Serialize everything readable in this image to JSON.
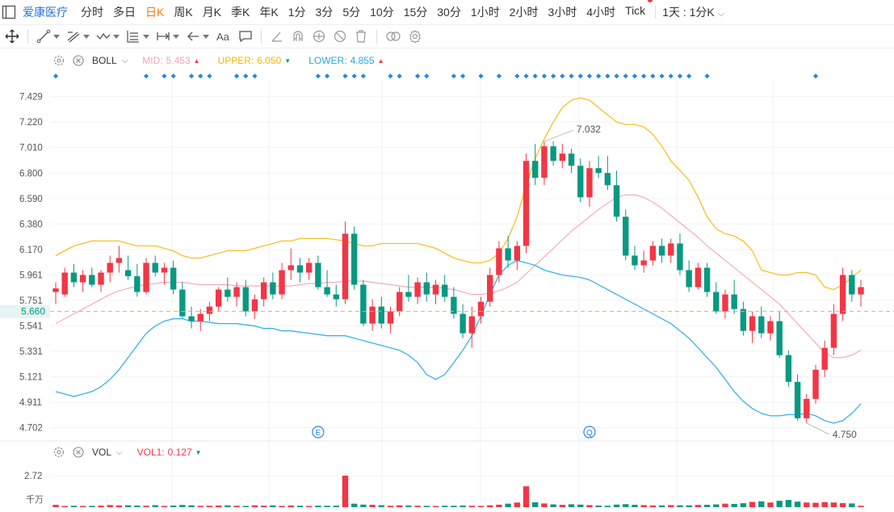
{
  "stock_name": "爱康医疗",
  "periods": [
    "分时",
    "多日",
    "日K",
    "周K",
    "月K",
    "季K",
    "年K",
    "1分",
    "3分",
    "5分",
    "10分",
    "15分",
    "30分",
    "1小时",
    "2小时",
    "3小时",
    "4小时",
    "Tick"
  ],
  "active_period": "日K",
  "range_label": "1天 : 1分K",
  "boll": {
    "name": "BOLL",
    "mid_label": "MID:",
    "mid": "5.453",
    "upper_label": "UPPER:",
    "upper": "6.050",
    "lower_label": "LOWER:",
    "lower": "4.855"
  },
  "vol": {
    "name": "VOL",
    "vol1_label": "VOL1:",
    "vol1": "0.127",
    "max_label": "2.72",
    "unit": "千万"
  },
  "colors": {
    "up": "#f23645",
    "down": "#089981",
    "mid": "#f5a3b8",
    "upper": "#f5c228",
    "lower": "#3ab4e6",
    "price_line": "#f5a56b",
    "accent": "#2a71d4",
    "active": "#f57a00"
  },
  "last_price": "5.660",
  "high_marker": "7.032",
  "low_marker": "4.750",
  "event_markers": [
    "E",
    "Q"
  ],
  "chart_data": {
    "type": "candlestick",
    "y_ticks": [
      "7.429",
      "7.220",
      "7.010",
      "6.800",
      "6.590",
      "6.380",
      "6.170",
      "5.961",
      "5.751",
      "5.541",
      "5.331",
      "5.121",
      "4.911",
      "4.702"
    ],
    "ylim": [
      4.6,
      7.56
    ],
    "n": 90,
    "ohlc": [
      [
        5.82,
        5.9,
        5.72,
        5.85
      ],
      [
        5.8,
        6.02,
        5.78,
        5.98
      ],
      [
        5.98,
        6.05,
        5.86,
        5.9
      ],
      [
        5.9,
        6.0,
        5.82,
        5.96
      ],
      [
        5.96,
        6.02,
        5.86,
        5.88
      ],
      [
        5.88,
        6.0,
        5.82,
        5.98
      ],
      [
        5.98,
        6.12,
        5.9,
        6.06
      ],
      [
        6.06,
        6.2,
        5.98,
        6.1
      ],
      [
        6.0,
        6.12,
        5.92,
        5.95
      ],
      [
        5.95,
        6.05,
        5.78,
        5.82
      ],
      [
        5.82,
        6.1,
        5.8,
        6.06
      ],
      [
        6.06,
        6.12,
        5.95,
        5.98
      ],
      [
        5.98,
        6.06,
        5.88,
        6.02
      ],
      [
        6.02,
        6.08,
        5.8,
        5.84
      ],
      [
        5.84,
        5.9,
        5.6,
        5.62
      ],
      [
        5.62,
        5.7,
        5.52,
        5.58
      ],
      [
        5.58,
        5.68,
        5.5,
        5.64
      ],
      [
        5.64,
        5.74,
        5.58,
        5.7
      ],
      [
        5.7,
        5.86,
        5.66,
        5.84
      ],
      [
        5.84,
        5.94,
        5.74,
        5.78
      ],
      [
        5.78,
        5.9,
        5.7,
        5.86
      ],
      [
        5.86,
        5.92,
        5.62,
        5.66
      ],
      [
        5.66,
        5.8,
        5.6,
        5.76
      ],
      [
        5.76,
        5.94,
        5.7,
        5.9
      ],
      [
        5.9,
        5.98,
        5.76,
        5.8
      ],
      [
        5.8,
        6.06,
        5.76,
        6.0
      ],
      [
        6.0,
        6.18,
        5.92,
        6.04
      ],
      [
        6.04,
        6.1,
        5.9,
        5.98
      ],
      [
        5.98,
        6.1,
        5.92,
        6.06
      ],
      [
        6.06,
        6.12,
        5.84,
        5.86
      ],
      [
        5.86,
        6.0,
        5.78,
        5.8
      ],
      [
        5.8,
        5.88,
        5.7,
        5.76
      ],
      [
        5.76,
        6.4,
        5.72,
        6.3
      ],
      [
        6.3,
        6.36,
        5.84,
        5.88
      ],
      [
        5.88,
        5.92,
        5.54,
        5.56
      ],
      [
        5.56,
        5.76,
        5.5,
        5.7
      ],
      [
        5.7,
        5.78,
        5.52,
        5.56
      ],
      [
        5.56,
        5.7,
        5.48,
        5.66
      ],
      [
        5.66,
        5.86,
        5.62,
        5.82
      ],
      [
        5.82,
        5.96,
        5.74,
        5.78
      ],
      [
        5.78,
        5.94,
        5.72,
        5.9
      ],
      [
        5.9,
        5.98,
        5.74,
        5.8
      ],
      [
        5.8,
        5.92,
        5.72,
        5.88
      ],
      [
        5.88,
        5.96,
        5.74,
        5.78
      ],
      [
        5.78,
        5.86,
        5.6,
        5.64
      ],
      [
        5.64,
        5.72,
        5.44,
        5.48
      ],
      [
        5.48,
        5.7,
        5.36,
        5.62
      ],
      [
        5.62,
        5.78,
        5.56,
        5.74
      ],
      [
        5.74,
        6.02,
        5.7,
        5.96
      ],
      [
        5.96,
        6.24,
        5.9,
        6.18
      ],
      [
        6.18,
        6.28,
        6.02,
        6.08
      ],
      [
        6.08,
        6.24,
        6.0,
        6.2
      ],
      [
        6.2,
        6.96,
        6.14,
        6.9
      ],
      [
        6.9,
        7.04,
        6.7,
        6.76
      ],
      [
        6.76,
        7.06,
        6.7,
        7.02
      ],
      [
        7.02,
        7.06,
        6.86,
        6.9
      ],
      [
        6.9,
        7.04,
        6.84,
        6.96
      ],
      [
        6.96,
        7.0,
        6.8,
        6.86
      ],
      [
        6.86,
        6.92,
        6.56,
        6.6
      ],
      [
        6.6,
        6.9,
        6.52,
        6.84
      ],
      [
        6.84,
        6.94,
        6.76,
        6.8
      ],
      [
        6.8,
        6.94,
        6.66,
        6.7
      ],
      [
        6.7,
        6.82,
        6.4,
        6.44
      ],
      [
        6.44,
        6.5,
        6.08,
        6.12
      ],
      [
        6.12,
        6.2,
        6.0,
        6.04
      ],
      [
        6.04,
        6.16,
        5.98,
        6.08
      ],
      [
        6.08,
        6.24,
        6.04,
        6.2
      ],
      [
        6.2,
        6.26,
        6.06,
        6.12
      ],
      [
        6.12,
        6.26,
        6.06,
        6.22
      ],
      [
        6.22,
        6.3,
        5.96,
        6.0
      ],
      [
        6.0,
        6.08,
        5.82,
        5.86
      ],
      [
        5.86,
        6.06,
        5.84,
        6.02
      ],
      [
        6.02,
        6.06,
        5.78,
        5.82
      ],
      [
        5.82,
        5.9,
        5.64,
        5.66
      ],
      [
        5.66,
        5.84,
        5.6,
        5.8
      ],
      [
        5.8,
        5.92,
        5.64,
        5.68
      ],
      [
        5.68,
        5.74,
        5.46,
        5.5
      ],
      [
        5.5,
        5.66,
        5.4,
        5.62
      ],
      [
        5.62,
        5.7,
        5.44,
        5.48
      ],
      [
        5.48,
        5.62,
        5.42,
        5.58
      ],
      [
        5.58,
        5.66,
        5.28,
        5.3
      ],
      [
        5.3,
        5.34,
        5.04,
        5.08
      ],
      [
        5.08,
        5.14,
        4.76,
        4.78
      ],
      [
        4.78,
        4.98,
        4.74,
        4.94
      ],
      [
        4.94,
        5.22,
        4.9,
        5.18
      ],
      [
        5.18,
        5.42,
        5.12,
        5.36
      ],
      [
        5.36,
        5.72,
        5.3,
        5.64
      ],
      [
        5.64,
        6.02,
        5.58,
        5.96
      ],
      [
        5.96,
        6.0,
        5.74,
        5.8
      ],
      [
        5.8,
        5.92,
        5.7,
        5.86
      ]
    ],
    "boll_mid": [
      5.56,
      5.6,
      5.64,
      5.68,
      5.72,
      5.76,
      5.8,
      5.83,
      5.85,
      5.87,
      5.88,
      5.89,
      5.9,
      5.9,
      5.9,
      5.89,
      5.88,
      5.88,
      5.88,
      5.88,
      5.87,
      5.87,
      5.87,
      5.87,
      5.87,
      5.87,
      5.87,
      5.88,
      5.89,
      5.89,
      5.9,
      5.9,
      5.91,
      5.91,
      5.91,
      5.9,
      5.89,
      5.88,
      5.87,
      5.86,
      5.86,
      5.86,
      5.86,
      5.85,
      5.84,
      5.82,
      5.8,
      5.8,
      5.81,
      5.83,
      5.86,
      5.9,
      5.97,
      6.04,
      6.11,
      6.18,
      6.25,
      6.32,
      6.38,
      6.44,
      6.5,
      6.55,
      6.6,
      6.62,
      6.62,
      6.6,
      6.56,
      6.51,
      6.45,
      6.39,
      6.33,
      6.27,
      6.2,
      6.14,
      6.08,
      6.02,
      5.96,
      5.9,
      5.84,
      5.78,
      5.72,
      5.64,
      5.56,
      5.48,
      5.4,
      5.32,
      5.28,
      5.28,
      5.3,
      5.34
    ],
    "boll_upper": [
      6.12,
      6.16,
      6.2,
      6.22,
      6.24,
      6.24,
      6.24,
      6.24,
      6.22,
      6.2,
      6.2,
      6.2,
      6.18,
      6.16,
      6.12,
      6.1,
      6.1,
      6.12,
      6.14,
      6.16,
      6.16,
      6.16,
      6.18,
      6.2,
      6.22,
      6.24,
      6.24,
      6.26,
      6.26,
      6.26,
      6.26,
      6.25,
      6.24,
      6.22,
      6.2,
      6.2,
      6.22,
      6.22,
      6.22,
      6.22,
      6.22,
      6.2,
      6.18,
      6.14,
      6.1,
      6.08,
      6.06,
      6.06,
      6.08,
      6.14,
      6.26,
      6.44,
      6.7,
      6.92,
      7.08,
      7.22,
      7.34,
      7.4,
      7.42,
      7.4,
      7.34,
      7.28,
      7.22,
      7.2,
      7.2,
      7.18,
      7.12,
      7.02,
      6.9,
      6.82,
      6.74,
      6.6,
      6.44,
      6.34,
      6.3,
      6.28,
      6.24,
      6.16,
      6.0,
      5.98,
      5.96,
      5.96,
      5.98,
      5.98,
      5.96,
      5.86,
      5.84,
      5.88,
      5.94,
      6.0
    ],
    "boll_lower": [
      5.0,
      4.98,
      4.96,
      4.98,
      5.0,
      5.04,
      5.1,
      5.18,
      5.28,
      5.38,
      5.48,
      5.54,
      5.58,
      5.6,
      5.6,
      5.58,
      5.58,
      5.57,
      5.56,
      5.56,
      5.56,
      5.55,
      5.54,
      5.52,
      5.52,
      5.5,
      5.5,
      5.49,
      5.48,
      5.47,
      5.46,
      5.46,
      5.46,
      5.44,
      5.42,
      5.4,
      5.38,
      5.36,
      5.34,
      5.3,
      5.24,
      5.14,
      5.1,
      5.14,
      5.24,
      5.34,
      5.46,
      5.62,
      5.8,
      5.96,
      6.04,
      6.08,
      6.06,
      6.04,
      6.0,
      5.98,
      5.96,
      5.95,
      5.94,
      5.92,
      5.88,
      5.84,
      5.8,
      5.76,
      5.72,
      5.68,
      5.64,
      5.6,
      5.56,
      5.5,
      5.44,
      5.36,
      5.28,
      5.2,
      5.1,
      5.0,
      4.92,
      4.86,
      4.82,
      4.8,
      4.8,
      4.81,
      4.81,
      4.82,
      4.8,
      4.76,
      4.74,
      4.76,
      4.82,
      4.9
    ],
    "volume_max": 2.72,
    "volumes": [
      0.2,
      0.1,
      0.12,
      0.1,
      0.11,
      0.13,
      0.18,
      0.15,
      0.16,
      0.14,
      0.12,
      0.17,
      0.11,
      0.14,
      0.19,
      0.16,
      0.11,
      0.12,
      0.14,
      0.15,
      0.12,
      0.1,
      0.16,
      0.13,
      0.15,
      0.11,
      0.14,
      0.12,
      0.1,
      0.13,
      0.12,
      0.13,
      2.72,
      0.3,
      0.22,
      0.2,
      0.17,
      0.12,
      0.16,
      0.14,
      0.12,
      0.11,
      0.1,
      0.12,
      0.12,
      0.14,
      0.12,
      0.11,
      0.16,
      0.21,
      0.3,
      0.4,
      1.8,
      0.42,
      0.32,
      0.24,
      0.2,
      0.25,
      0.22,
      0.18,
      0.14,
      0.12,
      0.22,
      0.26,
      0.2,
      0.18,
      0.14,
      0.15,
      0.18,
      0.16,
      0.15,
      0.19,
      0.2,
      0.24,
      0.3,
      0.28,
      0.34,
      0.45,
      0.5,
      0.4,
      0.55,
      0.62,
      0.48,
      0.4,
      0.38,
      0.44,
      0.4,
      0.35,
      0.32,
      0.12
    ],
    "dots": [
      0,
      10,
      12,
      13,
      15,
      16,
      17,
      20,
      21,
      22,
      29,
      30,
      32,
      33,
      34,
      37,
      38,
      40,
      41,
      44,
      45,
      47,
      49,
      51,
      52,
      53,
      54,
      55,
      56,
      57,
      58,
      59,
      60,
      61,
      62,
      63,
      64,
      65,
      66,
      67,
      68,
      69,
      70,
      72,
      84
    ],
    "event_markers_pos": [
      [
        29,
        "E"
      ],
      [
        59,
        "Q"
      ]
    ]
  }
}
